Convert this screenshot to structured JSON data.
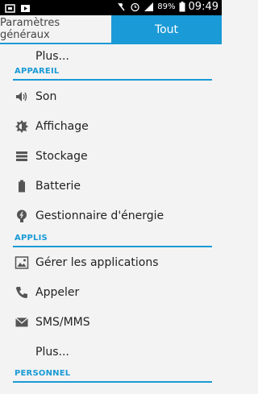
{
  "status_bar": {
    "battery": "89%",
    "time": "09:49"
  },
  "tabs": [
    {
      "label": "Paramètres généraux"
    },
    {
      "label": "Tout"
    }
  ],
  "items": {
    "more_top": "Plus...",
    "section_device": "APPAREIL",
    "sound": "Son",
    "display": "Affichage",
    "storage": "Stockage",
    "battery": "Batterie",
    "power": "Gestionnaire d'énergie",
    "section_apps": "APPLIS",
    "manage_apps": "Gérer les applications",
    "call": "Appeler",
    "sms": "SMS/MMS",
    "more_apps": "Plus...",
    "section_personal": "PERSONNEL"
  }
}
